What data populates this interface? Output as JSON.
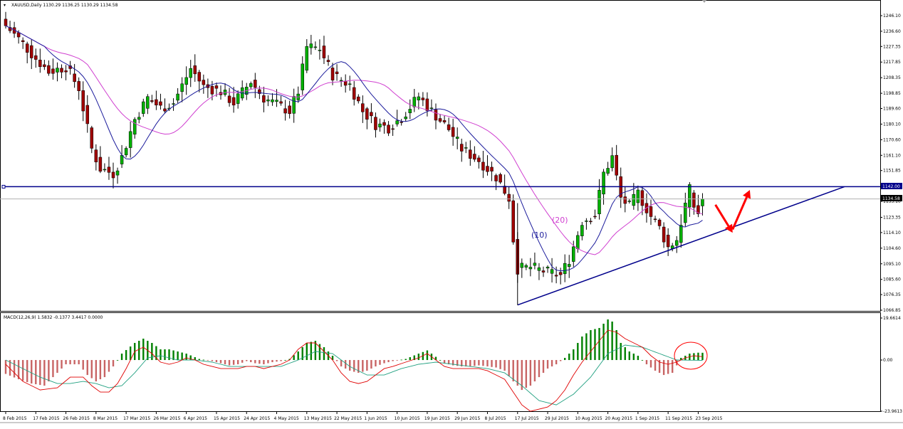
{
  "header": {
    "title": "XAUUSD,Daily  1130.29 1136.25 1130.29 1134.58"
  },
  "macd_label": "MACD(12,26,9) 1.5832 -0.1377 3.4417 0.0000",
  "price_labels": {
    "resistance": "1142.00",
    "current": "1134.58"
  },
  "annotations": {
    "ma10": "(10)",
    "ma20": "(20)"
  },
  "colors": {
    "bull": "#00b000",
    "bear": "#a00000",
    "ma10": "#1c1c9c",
    "ma20": "#d040d0",
    "resistance_line": "#00008b",
    "trend_line": "#00008b",
    "signal_arrow": "#ff0000",
    "macd_pos": "#008000",
    "macd_neg": "#c86464",
    "macd_line": "#e00000",
    "signal_line": "#20a080"
  },
  "chart_data": [
    {
      "type": "candlestick",
      "symbol": "XAUUSD",
      "timeframe": "Daily",
      "y_ticks": [
        "1246.10",
        "1236.60",
        "1227.35",
        "1217.85",
        "1208.35",
        "1198.85",
        "1189.60",
        "1180.10",
        "1170.60",
        "1161.10",
        "1151.85",
        "1142.35",
        "1133.10",
        "1123.35",
        "1114.10",
        "1104.60",
        "1095.10",
        "1085.60",
        "1076.35",
        "1066.85"
      ],
      "ylim": [
        1066.85,
        1250
      ],
      "x_labels": [
        {
          "i": 0,
          "label": "8 Feb 2015"
        },
        {
          "i": 7,
          "label": "17 Feb 2015"
        },
        {
          "i": 14,
          "label": "26 Feb 2015"
        },
        {
          "i": 21,
          "label": "8 Mar 2015"
        },
        {
          "i": 28,
          "label": "17 Mar 2015"
        },
        {
          "i": 35,
          "label": "26 Mar 2015"
        },
        {
          "i": 42,
          "label": "6 Apr 2015"
        },
        {
          "i": 49,
          "label": "15 Apr 2015"
        },
        {
          "i": 56,
          "label": "24 Apr 2015"
        },
        {
          "i": 63,
          "label": "4 May 2015"
        },
        {
          "i": 70,
          "label": "13 May 2015"
        },
        {
          "i": 77,
          "label": "22 May 2015"
        },
        {
          "i": 84,
          "label": "1 Jun 2015"
        },
        {
          "i": 91,
          "label": "10 Jun 2015"
        },
        {
          "i": 98,
          "label": "19 Jun 2015"
        },
        {
          "i": 105,
          "label": "29 Jun 2015"
        },
        {
          "i": 112,
          "label": "8 Jul 2015"
        },
        {
          "i": 119,
          "label": "17 Jul 2015"
        },
        {
          "i": 126,
          "label": "29 Jul 2015"
        },
        {
          "i": 133,
          "label": "10 Aug 2015"
        },
        {
          "i": 140,
          "label": "20 Aug 2015"
        },
        {
          "i": 147,
          "label": "1 Sep 2015"
        },
        {
          "i": 154,
          "label": "11 Sep 2015"
        },
        {
          "i": 161,
          "label": "23 Sep 2015"
        }
      ],
      "anchors": [
        [
          0,
          1240
        ],
        [
          3,
          1232
        ],
        [
          7,
          1220
        ],
        [
          10,
          1212
        ],
        [
          14,
          1215
        ],
        [
          17,
          1202
        ],
        [
          20,
          1165
        ],
        [
          22,
          1153
        ],
        [
          25,
          1150
        ],
        [
          27,
          1160
        ],
        [
          30,
          1183
        ],
        [
          33,
          1196
        ],
        [
          36,
          1190
        ],
        [
          39,
          1193
        ],
        [
          43,
          1214
        ],
        [
          46,
          1203
        ],
        [
          50,
          1200
        ],
        [
          53,
          1193
        ],
        [
          57,
          1206
        ],
        [
          60,
          1196
        ],
        [
          63,
          1192
        ],
        [
          66,
          1188
        ],
        [
          68,
          1200
        ],
        [
          70,
          1227
        ],
        [
          73,
          1226
        ],
        [
          76,
          1210
        ],
        [
          80,
          1204
        ],
        [
          83,
          1188
        ],
        [
          86,
          1180
        ],
        [
          89,
          1178
        ],
        [
          92,
          1184
        ],
        [
          96,
          1197
        ],
        [
          99,
          1188
        ],
        [
          103,
          1177
        ],
        [
          106,
          1165
        ],
        [
          110,
          1158
        ],
        [
          114,
          1148
        ],
        [
          117,
          1135
        ],
        [
          118,
          1110
        ],
        [
          119,
          1092
        ],
        [
          122,
          1093
        ],
        [
          126,
          1090
        ],
        [
          129,
          1088
        ],
        [
          131,
          1098
        ],
        [
          134,
          1121
        ],
        [
          137,
          1125
        ],
        [
          139,
          1150
        ],
        [
          141,
          1160
        ],
        [
          143,
          1135
        ],
        [
          145,
          1130
        ],
        [
          147,
          1138
        ],
        [
          150,
          1124
        ],
        [
          152,
          1117
        ],
        [
          154,
          1105
        ],
        [
          156,
          1110
        ],
        [
          158,
          1131
        ],
        [
          159,
          1140
        ],
        [
          160,
          1130
        ],
        [
          161,
          1126
        ],
        [
          162,
          1134.58
        ]
      ],
      "resistance": 1142.0,
      "current_price": 1134.58,
      "trend_line": {
        "from": [
          119,
          1070
        ],
        "to": [
          195,
          1142
        ]
      },
      "arrow_1": {
        "from": [
          165,
          1131
        ],
        "to": [
          169,
          1114
        ]
      },
      "arrow_2": {
        "from": [
          169,
          1116
        ],
        "to": [
          173,
          1140
        ]
      }
    },
    {
      "type": "bar",
      "name": "MACD(12,26,9)",
      "y_ticks": [
        "19.6614",
        "0.00",
        "-23.9613"
      ],
      "ylim": [
        -23.9613,
        19.6614
      ],
      "anchors": [
        [
          0,
          -6.5
        ],
        [
          3,
          -9
        ],
        [
          6,
          -11
        ],
        [
          9,
          -12
        ],
        [
          11,
          -8
        ],
        [
          14,
          -2
        ],
        [
          17,
          -2
        ],
        [
          19,
          -7
        ],
        [
          21,
          -10
        ],
        [
          23,
          -8
        ],
        [
          25,
          -3
        ],
        [
          27,
          3
        ],
        [
          30,
          8
        ],
        [
          32,
          10
        ],
        [
          34,
          8
        ],
        [
          36,
          5
        ],
        [
          38,
          5
        ],
        [
          40,
          4
        ],
        [
          42,
          3
        ],
        [
          45,
          0.5
        ],
        [
          48,
          -0.5
        ],
        [
          50,
          -1.5
        ],
        [
          52,
          -2.5
        ],
        [
          54,
          -2
        ],
        [
          56,
          -0.5
        ],
        [
          58,
          -1.5
        ],
        [
          60,
          -2
        ],
        [
          62,
          -1
        ],
        [
          64,
          -0.5
        ],
        [
          66,
          0.5
        ],
        [
          68,
          4
        ],
        [
          70,
          8
        ],
        [
          72,
          9
        ],
        [
          74,
          6
        ],
        [
          76,
          2
        ],
        [
          78,
          -3
        ],
        [
          80,
          -5
        ],
        [
          82,
          -6
        ],
        [
          84,
          -5
        ],
        [
          86,
          -3
        ],
        [
          88,
          -1.5
        ],
        [
          90,
          -0.5
        ],
        [
          93,
          0.5
        ],
        [
          96,
          3
        ],
        [
          98,
          4.5
        ],
        [
          100,
          1.5
        ],
        [
          102,
          -1.5
        ],
        [
          104,
          -2.5
        ],
        [
          106,
          -3
        ],
        [
          108,
          -3
        ],
        [
          110,
          -2.5
        ],
        [
          112,
          -3
        ],
        [
          114,
          -3.5
        ],
        [
          116,
          -5
        ],
        [
          118,
          -10
        ],
        [
          120,
          -14
        ],
        [
          122,
          -12
        ],
        [
          124,
          -8
        ],
        [
          126,
          -4
        ],
        [
          128,
          -2
        ],
        [
          130,
          1
        ],
        [
          132,
          5
        ],
        [
          134,
          11
        ],
        [
          136,
          14
        ],
        [
          138,
          15
        ],
        [
          140,
          19
        ],
        [
          141,
          18
        ],
        [
          142,
          14
        ],
        [
          143,
          8
        ],
        [
          145,
          4
        ],
        [
          147,
          2
        ],
        [
          149,
          -2
        ],
        [
          151,
          -5
        ],
        [
          153,
          -7
        ],
        [
          155,
          -6
        ],
        [
          157,
          1
        ],
        [
          159,
          3
        ],
        [
          161,
          3.4417
        ],
        [
          162,
          3.4
        ]
      ],
      "macd_line_anchors": [
        [
          0,
          -2
        ],
        [
          4,
          -10
        ],
        [
          8,
          -14
        ],
        [
          12,
          -13
        ],
        [
          15,
          -8
        ],
        [
          18,
          -8
        ],
        [
          20,
          -12
        ],
        [
          22,
          -15
        ],
        [
          24,
          -15
        ],
        [
          26,
          -11
        ],
        [
          28,
          -4
        ],
        [
          30,
          4
        ],
        [
          32,
          6
        ],
        [
          34,
          3
        ],
        [
          36,
          -1
        ],
        [
          38,
          -2
        ],
        [
          40,
          -1
        ],
        [
          42,
          1
        ],
        [
          44,
          0
        ],
        [
          46,
          -2
        ],
        [
          48,
          -3
        ],
        [
          50,
          -4
        ],
        [
          52,
          -4
        ],
        [
          54,
          -4
        ],
        [
          56,
          -3
        ],
        [
          58,
          -3
        ],
        [
          60,
          -4
        ],
        [
          62,
          -3
        ],
        [
          64,
          -2
        ],
        [
          66,
          0
        ],
        [
          68,
          5
        ],
        [
          70,
          8
        ],
        [
          72,
          8
        ],
        [
          74,
          4
        ],
        [
          76,
          0
        ],
        [
          78,
          -6
        ],
        [
          80,
          -10
        ],
        [
          82,
          -11
        ],
        [
          84,
          -10
        ],
        [
          86,
          -7
        ],
        [
          88,
          -4
        ],
        [
          90,
          -3
        ],
        [
          93,
          -1
        ],
        [
          96,
          1
        ],
        [
          98,
          3
        ],
        [
          100,
          0
        ],
        [
          102,
          -3
        ],
        [
          104,
          -4
        ],
        [
          106,
          -4
        ],
        [
          108,
          -4
        ],
        [
          110,
          -4
        ],
        [
          112,
          -5
        ],
        [
          114,
          -7
        ],
        [
          116,
          -9
        ],
        [
          118,
          -15
        ],
        [
          120,
          -21
        ],
        [
          122,
          -24
        ],
        [
          124,
          -23
        ],
        [
          126,
          -22
        ],
        [
          128,
          -19
        ],
        [
          130,
          -14
        ],
        [
          132,
          -7
        ],
        [
          134,
          -1
        ],
        [
          136,
          4
        ],
        [
          138,
          9
        ],
        [
          140,
          14
        ],
        [
          142,
          13
        ],
        [
          144,
          10
        ],
        [
          146,
          8
        ],
        [
          148,
          6
        ],
        [
          150,
          2
        ],
        [
          152,
          -1
        ],
        [
          154,
          -2
        ],
        [
          156,
          -1
        ],
        [
          158,
          1
        ],
        [
          160,
          2
        ],
        [
          162,
          1.5832
        ]
      ],
      "signal_line_anchors": [
        [
          0,
          0
        ],
        [
          4,
          -4
        ],
        [
          8,
          -8
        ],
        [
          12,
          -11
        ],
        [
          15,
          -11
        ],
        [
          18,
          -10
        ],
        [
          21,
          -11
        ],
        [
          24,
          -13
        ],
        [
          27,
          -12
        ],
        [
          30,
          -6
        ],
        [
          33,
          1
        ],
        [
          36,
          2
        ],
        [
          40,
          0
        ],
        [
          44,
          0
        ],
        [
          48,
          -1
        ],
        [
          52,
          -3
        ],
        [
          56,
          -3
        ],
        [
          60,
          -3
        ],
        [
          64,
          -3
        ],
        [
          68,
          0
        ],
        [
          72,
          4
        ],
        [
          76,
          3
        ],
        [
          80,
          -3
        ],
        [
          84,
          -7
        ],
        [
          88,
          -7
        ],
        [
          92,
          -4
        ],
        [
          96,
          -2
        ],
        [
          100,
          -1
        ],
        [
          104,
          -2
        ],
        [
          108,
          -3
        ],
        [
          112,
          -4
        ],
        [
          116,
          -6
        ],
        [
          120,
          -12
        ],
        [
          124,
          -19
        ],
        [
          128,
          -21
        ],
        [
          132,
          -16
        ],
        [
          136,
          -8
        ],
        [
          140,
          3
        ],
        [
          144,
          7
        ],
        [
          148,
          6
        ],
        [
          152,
          3
        ],
        [
          156,
          0
        ],
        [
          160,
          -0.1
        ],
        [
          162,
          -0.1377
        ]
      ]
    }
  ]
}
